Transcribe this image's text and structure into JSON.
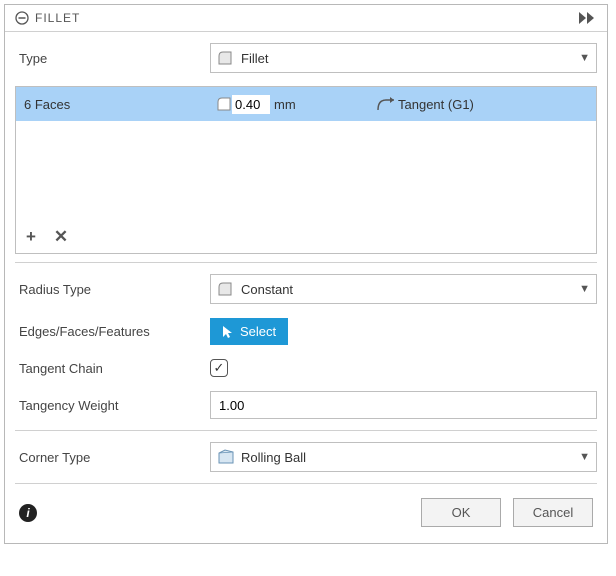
{
  "title": "FILLET",
  "type": {
    "label": "Type",
    "value": "Fillet"
  },
  "selection": {
    "faces_label": "6 Faces",
    "value": "0.40",
    "unit": "mm",
    "continuity": "Tangent (G1)"
  },
  "radiusType": {
    "label": "Radius Type",
    "value": "Constant"
  },
  "edges": {
    "label": "Edges/Faces/Features",
    "button": "Select"
  },
  "tangentChain": {
    "label": "Tangent Chain",
    "checked": true
  },
  "tangencyWeight": {
    "label": "Tangency Weight",
    "value": "1.00"
  },
  "cornerType": {
    "label": "Corner Type",
    "value": "Rolling Ball"
  },
  "actions": {
    "ok": "OK",
    "cancel": "Cancel"
  }
}
